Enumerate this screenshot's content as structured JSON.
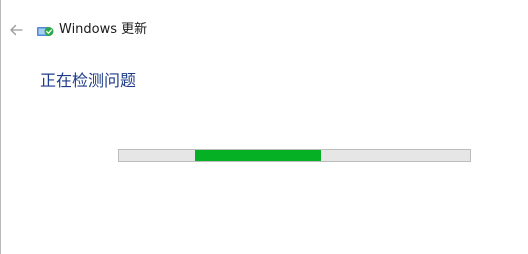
{
  "window": {
    "title": "Windows 更新"
  },
  "page": {
    "heading": "正在检测问题"
  },
  "progress": {
    "start_fraction": 0.216,
    "fraction": 0.36,
    "fill_color": "#06b025"
  },
  "icons": {
    "back": "arrow-left-icon",
    "app": "windows-update-icon"
  }
}
